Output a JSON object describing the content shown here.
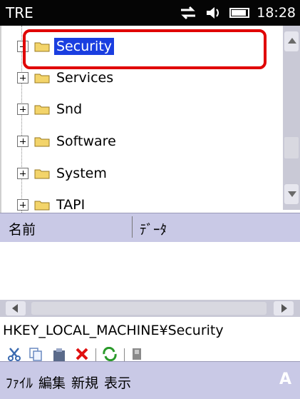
{
  "statusbar": {
    "app_title": "TRE",
    "time": "18:28"
  },
  "tree": {
    "items": [
      {
        "label": "Security",
        "selected": true
      },
      {
        "label": "Services",
        "selected": false
      },
      {
        "label": "Snd",
        "selected": false
      },
      {
        "label": "Software",
        "selected": false
      },
      {
        "label": "System",
        "selected": false
      },
      {
        "label": "TAPI",
        "selected": false
      }
    ]
  },
  "list": {
    "columns": [
      "名前",
      "ﾃﾞｰﾀ"
    ]
  },
  "path": "HKEY_LOCAL_MACHINE¥Security",
  "toolbar": {
    "icons": [
      "cut-icon",
      "copy-icon",
      "paste-icon",
      "delete-icon",
      "refresh-icon",
      "search-icon"
    ]
  },
  "menubar": {
    "items": [
      "ﾌｧｲﾙ",
      "編集",
      "新規",
      "表示"
    ],
    "ime_indicator": "A"
  },
  "colors": {
    "selection": "#1a3ee0",
    "highlight": "#e00000",
    "bars": "#c9c9e6"
  }
}
